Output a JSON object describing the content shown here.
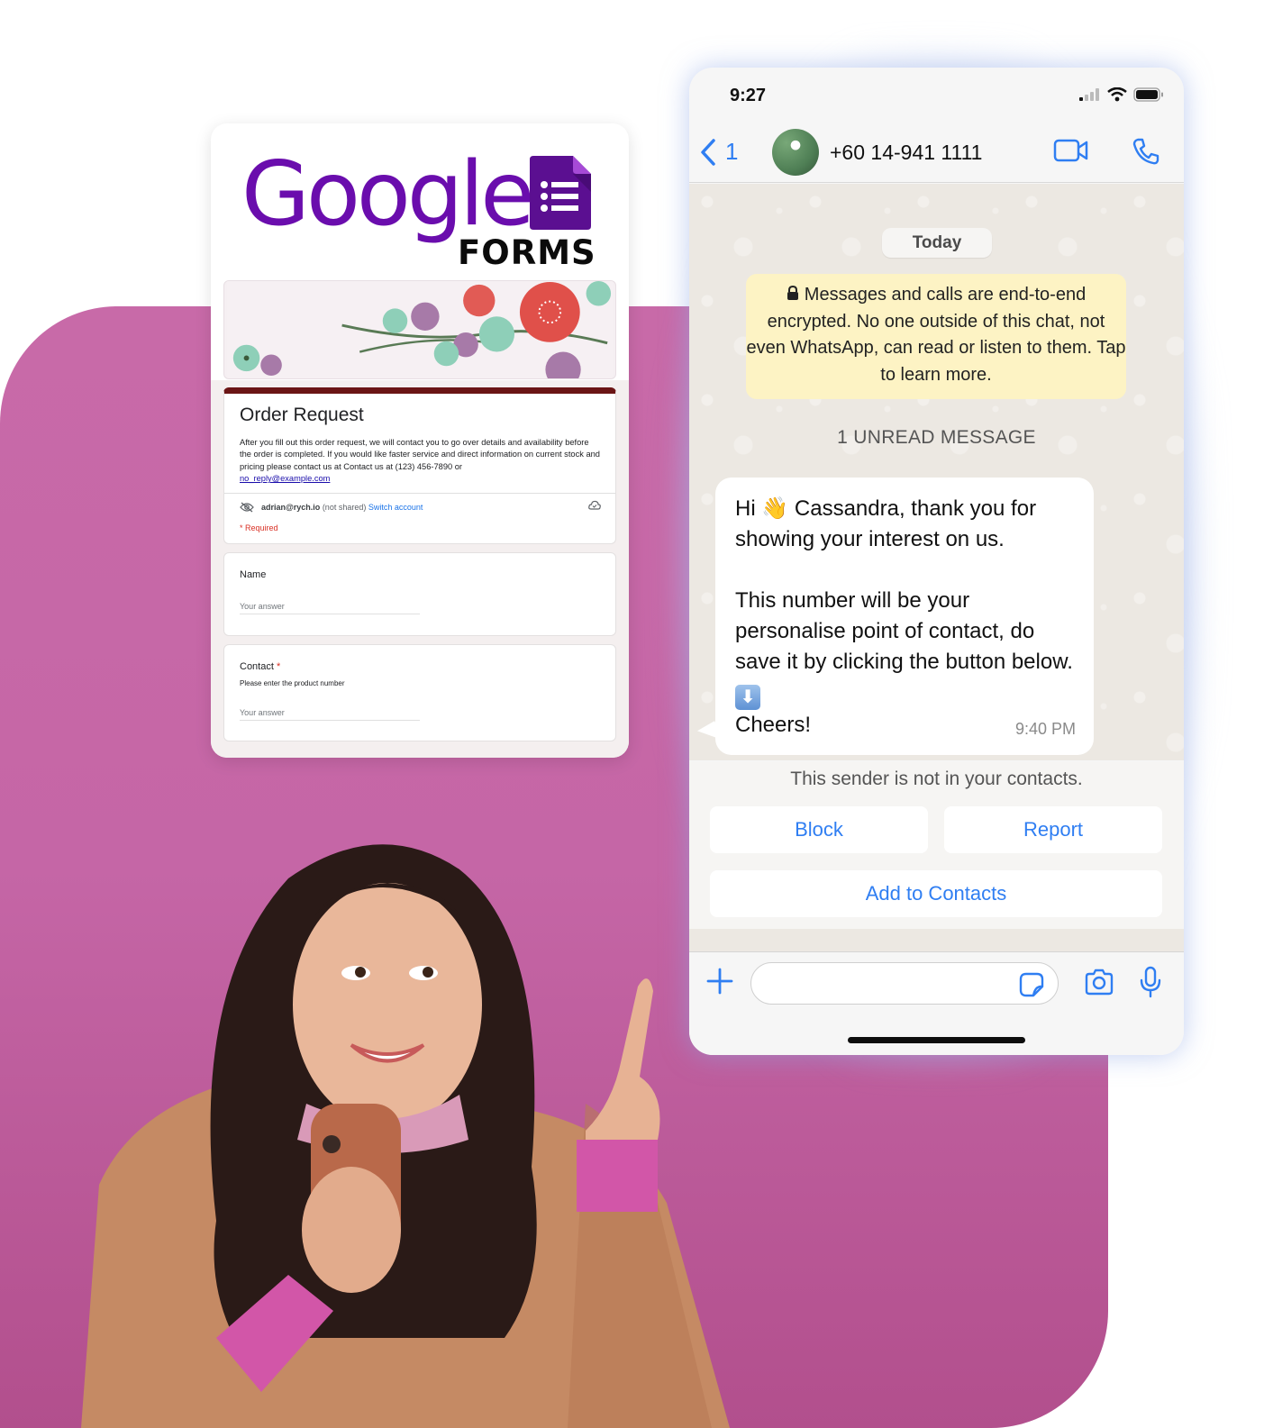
{
  "colors": {
    "background_panel": "#c566a6",
    "google_forms_purple": "#6a0dad",
    "form_header_accent": "#6b1515",
    "whatsapp_link_blue": "#2f7ef2",
    "encryption_notice_bg": "#fdf3c4",
    "required_red": "#d93025"
  },
  "google_forms": {
    "logo_word": "Google",
    "logo_subword": "FORMS",
    "logo_icon": "forms-document-icon",
    "form": {
      "title": "Order Request",
      "description": "After you fill out this order request, we will contact you to go over details and availability before the order is completed. If you would like faster service and direct information on current stock and pricing please contact us at Contact us at (123) 456-7890 or",
      "email_link": "no_reply@example.com",
      "account_email": "adrian@rych.io",
      "account_shared_note": "(not shared)",
      "switch_account": "Switch account",
      "required_note": "* Required"
    },
    "questions": [
      {
        "label": "Name",
        "required": false,
        "hint": "",
        "placeholder": "Your answer"
      },
      {
        "label": "Contact",
        "required": true,
        "hint": "Please enter the product number",
        "placeholder": "Your answer"
      }
    ]
  },
  "whatsapp": {
    "status_bar": {
      "time": "9:27"
    },
    "header": {
      "back_count": "1",
      "contact_name": "+60 14-941 1111"
    },
    "day_chip": "Today",
    "encryption_notice": "Messages and calls are end-to-end encrypted. No one outside of this chat, not even WhatsApp, can read or listen to them. Tap to learn more.",
    "unread_label": "1 UNREAD MESSAGE",
    "message": {
      "line1_pre": "Hi",
      "line1_emoji": "👋",
      "line1_post": "Cassandra, thank you for showing your interest on us.",
      "paragraph2": "This number will be your personalise point of contact, do save it by clicking the button below.",
      "down_emoji": "⬇",
      "closing": "Cheers!",
      "time": "9:40 PM"
    },
    "not_in_contacts": "This sender is not in your contacts.",
    "buttons": {
      "block": "Block",
      "report": "Report",
      "add_to_contacts": "Add to Contacts"
    },
    "composer": {
      "placeholder": ""
    }
  }
}
